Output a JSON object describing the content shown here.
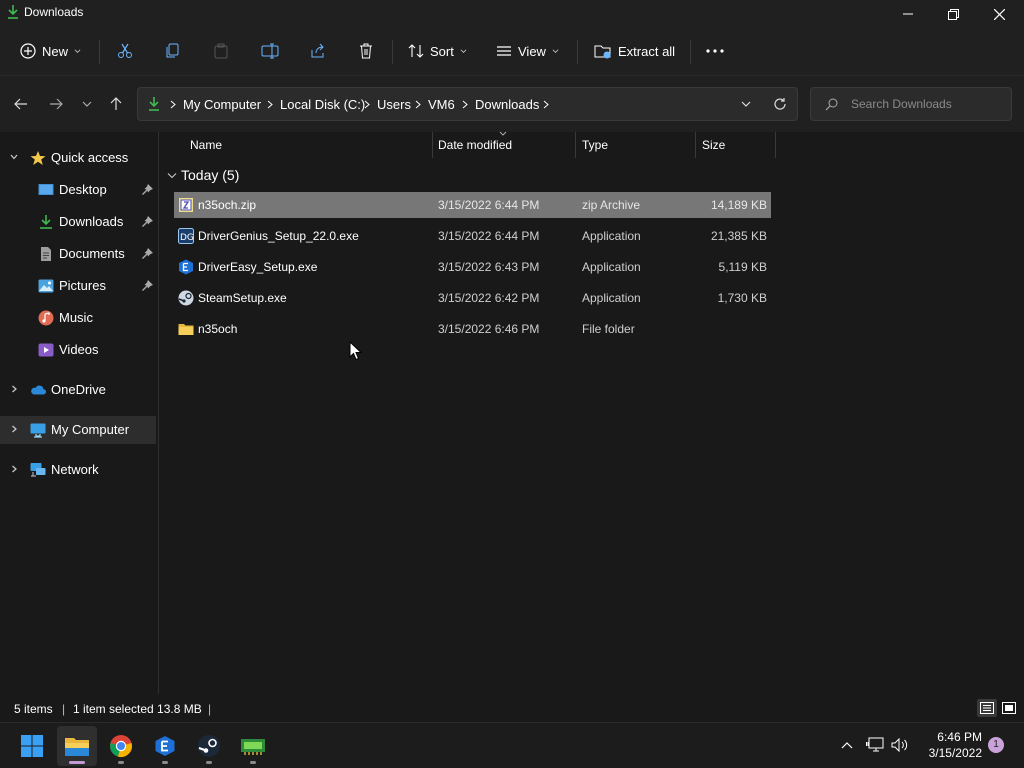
{
  "window": {
    "title": "Downloads",
    "icon": "download-arrow-icon"
  },
  "commandbar": {
    "new_label": "New",
    "sort_label": "Sort",
    "view_label": "View",
    "extract_label": "Extract all",
    "icons": [
      "new-plus-icon",
      "cut-icon",
      "copy-icon",
      "paste-icon",
      "rename-icon",
      "share-icon",
      "delete-icon",
      "sort-icon",
      "view-icon",
      "extract-icon",
      "more-icon"
    ]
  },
  "address": {
    "crumbs": [
      "My Computer",
      "Local Disk (C:)",
      "Users",
      "VM6",
      "Downloads"
    ],
    "search_placeholder": "Search Downloads"
  },
  "navpane": {
    "quick_access": "Quick access",
    "items": [
      {
        "label": "Desktop",
        "icon": "desktop-icon",
        "pinned": true
      },
      {
        "label": "Downloads",
        "icon": "downloads-icon",
        "pinned": true
      },
      {
        "label": "Documents",
        "icon": "documents-icon",
        "pinned": true
      },
      {
        "label": "Pictures",
        "icon": "pictures-icon",
        "pinned": true
      },
      {
        "label": "Music",
        "icon": "music-icon",
        "pinned": false
      },
      {
        "label": "Videos",
        "icon": "videos-icon",
        "pinned": false
      }
    ],
    "onedrive": "OneDrive",
    "mycomputer": "My Computer",
    "network": "Network"
  },
  "columns": {
    "name": "Name",
    "date": "Date modified",
    "type": "Type",
    "size": "Size"
  },
  "group": {
    "title": "Today (5)"
  },
  "files": [
    {
      "name": "n35och.zip",
      "date": "3/15/2022 6:44 PM",
      "type": "zip Archive",
      "size": "14,189 KB",
      "icon": "zip-archive-icon",
      "selected": true
    },
    {
      "name": "DriverGenius_Setup_22.0.exe",
      "date": "3/15/2022 6:44 PM",
      "type": "Application",
      "size": "21,385 KB",
      "icon": "drivergenius-icon",
      "selected": false
    },
    {
      "name": "DriverEasy_Setup.exe",
      "date": "3/15/2022 6:43 PM",
      "type": "Application",
      "size": "5,119 KB",
      "icon": "drivereasy-icon",
      "selected": false
    },
    {
      "name": "SteamSetup.exe",
      "date": "3/15/2022 6:42 PM",
      "type": "Application",
      "size": "1,730 KB",
      "icon": "steam-icon",
      "selected": false
    },
    {
      "name": "n35och",
      "date": "3/15/2022 6:46 PM",
      "type": "File folder",
      "size": "",
      "icon": "folder-icon",
      "selected": false
    }
  ],
  "status": {
    "items": "5 items",
    "selected": "1 item selected  13.8 MB"
  },
  "taskbar": {
    "apps": [
      "start-icon",
      "file-explorer-icon",
      "chrome-icon",
      "drivereasy-icon",
      "steam-icon",
      "drivergenius-icon"
    ],
    "time": "6:46 PM",
    "date": "3/15/2022",
    "notifications": "1"
  },
  "colors": {
    "background": "#191919",
    "chrome": "#202020",
    "selection": "#777777",
    "accent": "#c39bd3"
  }
}
